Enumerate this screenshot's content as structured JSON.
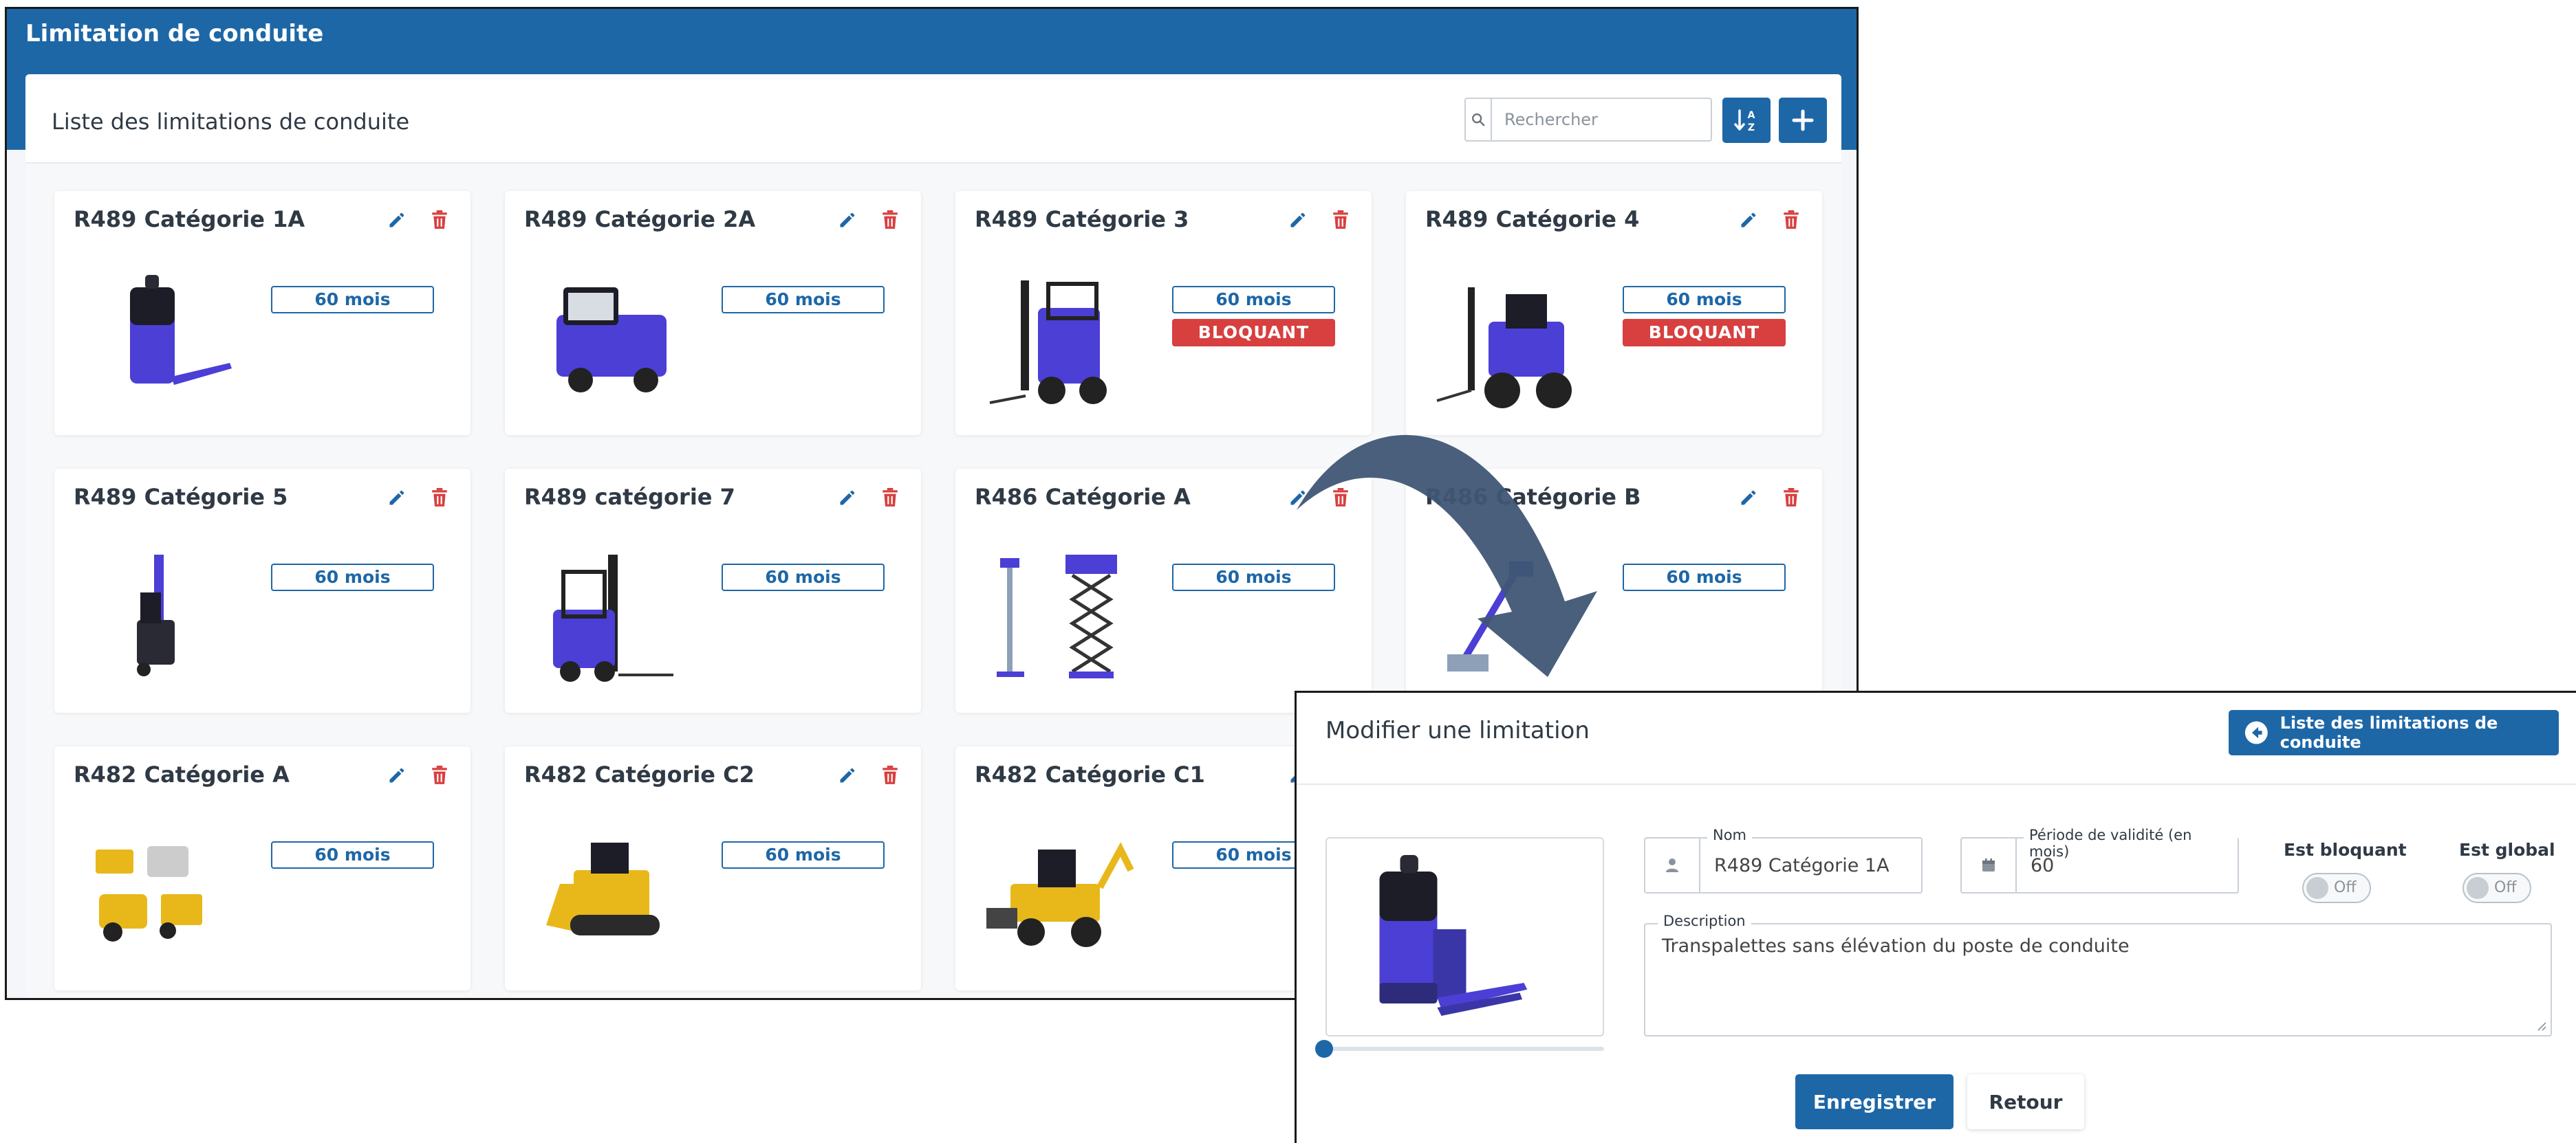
{
  "app": {
    "title": "Limitation de conduite"
  },
  "list": {
    "title": "Liste des limitations de conduite",
    "search_placeholder": "Rechercher",
    "sort_icon": "sort-alpha-icon",
    "add_icon": "plus-icon"
  },
  "cards": [
    {
      "title": "R489 Catégorie 1A",
      "period": "60 mois",
      "blocking": "",
      "image": "pallet-truck"
    },
    {
      "title": "R489 Catégorie 2A",
      "period": "60 mois",
      "blocking": "",
      "image": "tow-tractor"
    },
    {
      "title": "R489 Catégorie 3",
      "period": "60 mois",
      "blocking": "BLOQUANT",
      "image": "forklift"
    },
    {
      "title": "R489 Catégorie 4",
      "period": "60 mois",
      "blocking": "BLOQUANT",
      "image": "rough-terrain-forklift"
    },
    {
      "title": "R489 Catégorie 5",
      "period": "60 mois",
      "blocking": "",
      "image": "reach-truck"
    },
    {
      "title": "R489 catégorie 7",
      "period": "60 mois",
      "blocking": "",
      "image": "electric-forklift"
    },
    {
      "title": "R486 Catégorie A",
      "period": "60 mois",
      "blocking": "",
      "image": "mast-and-scissor-lift"
    },
    {
      "title": "R486 Catégorie B",
      "period": "60 mois",
      "blocking": "",
      "image": "boom-lift"
    },
    {
      "title": "R482 Catégorie A",
      "period": "60 mois",
      "blocking": "",
      "image": "compact-machines"
    },
    {
      "title": "R482 Catégorie C2",
      "period": "60 mois",
      "blocking": "",
      "image": "bulldozer"
    },
    {
      "title": "R482 Catégorie C1",
      "period": "60 mois",
      "blocking": "",
      "image": "backhoe-loader"
    }
  ],
  "modal": {
    "title": "Modifier une limitation",
    "back_button": "Liste des limitations de conduite",
    "name_label": "Nom",
    "name_value": "R489 Catégorie 1A",
    "period_label": "Période de validité (en mois)",
    "period_value": "60",
    "blocking_label": "Est bloquant",
    "blocking_state": "Off",
    "global_label": "Est global",
    "global_state": "Off",
    "description_label": "Description",
    "description_value": "Transpalettes sans élévation du poste de conduite",
    "save_button": "Enregistrer",
    "cancel_button": "Retour"
  },
  "colors": {
    "primary": "#1d67a7",
    "danger": "#d83f3f",
    "machine": "#4b3fd6",
    "arrow": "#3f5675"
  }
}
